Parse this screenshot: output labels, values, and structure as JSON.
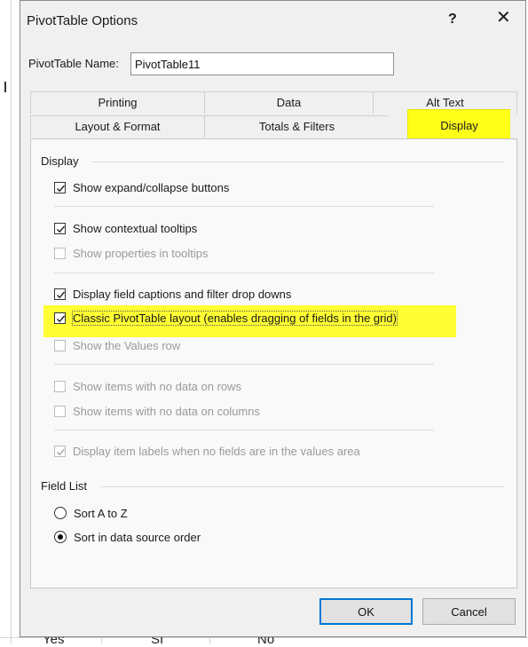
{
  "dialog": {
    "title": "PivotTable Options",
    "help_label": "?",
    "close_label": "✕"
  },
  "name_field": {
    "label": "PivotTable Name:",
    "value": "PivotTable11"
  },
  "tabs_row1": [
    {
      "label": "Printing"
    },
    {
      "label": "Data"
    },
    {
      "label": "Alt Text"
    }
  ],
  "tabs_row2": [
    {
      "label": "Layout & Format"
    },
    {
      "label": "Totals & Filters"
    },
    {
      "label": "Display",
      "active": true
    }
  ],
  "display_group": {
    "label": "Display",
    "options": [
      {
        "label": "Show expand/collapse buttons",
        "checked": true,
        "enabled": true
      },
      {
        "label": "Show contextual tooltips",
        "checked": true,
        "enabled": true
      },
      {
        "label": "Show properties in tooltips",
        "checked": false,
        "enabled": false
      },
      {
        "label": "Display field captions and filter drop downs",
        "checked": true,
        "enabled": true
      },
      {
        "label": "Classic PivotTable layout (enables dragging of fields in the grid)",
        "checked": true,
        "enabled": true,
        "highlighted": true
      },
      {
        "label": "Show the Values row",
        "checked": false,
        "enabled": false
      },
      {
        "label": "Show items with no data on rows",
        "checked": false,
        "enabled": false
      },
      {
        "label": "Show items with no data on columns",
        "checked": false,
        "enabled": false
      },
      {
        "label": "Display item labels when no fields are in the values area",
        "checked": true,
        "enabled": false
      }
    ]
  },
  "field_list_group": {
    "label": "Field List",
    "options": [
      {
        "label": "Sort A to Z",
        "selected": false
      },
      {
        "label": "Sort in data source order",
        "selected": true
      }
    ]
  },
  "buttons": {
    "ok": "OK",
    "cancel": "Cancel"
  },
  "background_cells": [
    "Yes",
    "SI",
    "No"
  ],
  "colors": {
    "highlight": "#ffff1a",
    "dialog_bg": "#f0f0f0",
    "default_button_border": "#0078d7"
  }
}
